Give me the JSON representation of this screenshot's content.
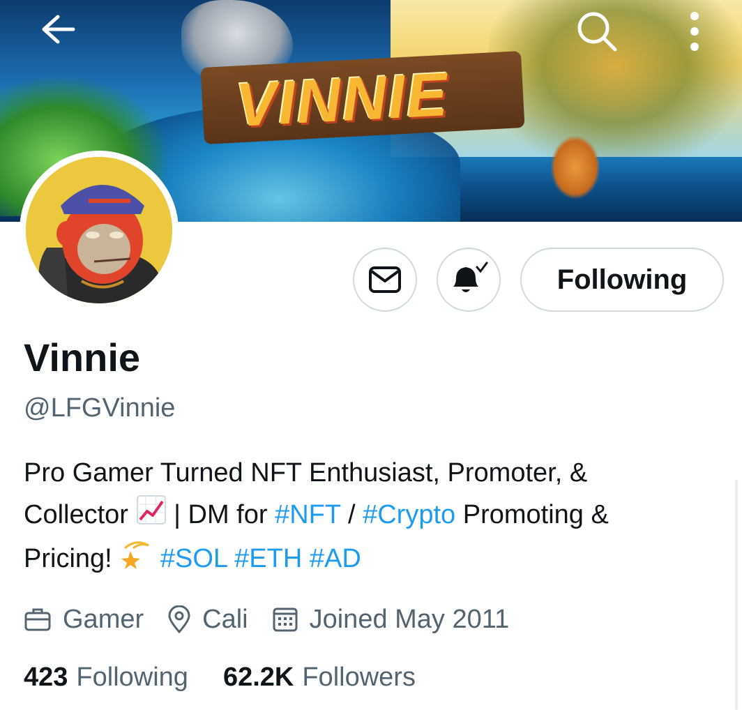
{
  "header": {
    "back_icon": "arrow-left-icon",
    "search_icon": "search-icon",
    "more_icon": "more-vertical-icon",
    "banner_logo_text": "VINNIE"
  },
  "profile": {
    "display_name": "Vinnie",
    "handle": "@LFGVinnie",
    "bio": {
      "line1": "Pro Gamer Turned NFT Enthusiast, Promoter, &",
      "line2_a": "Collector",
      "line2_b": "| DM for",
      "tag_nft": "#NFT",
      "sep": "/",
      "tag_crypto": "#Crypto",
      "line2_c": "Promoting &",
      "line3_a": "Pricing!",
      "tag_sol": "#SOL",
      "tag_eth": "#ETH",
      "tag_ad": "#AD"
    },
    "meta": {
      "category": "Gamer",
      "location": "Cali",
      "joined": "Joined May 2011"
    },
    "stats": {
      "following_count": "423",
      "following_label": "Following",
      "followers_count": "62.2K",
      "followers_label": "Followers"
    }
  },
  "actions": {
    "message_icon": "envelope-icon",
    "notify_icon": "bell-check-icon",
    "follow_label": "Following"
  },
  "colors": {
    "link": "#1d9bf0",
    "secondary_text": "#536471",
    "border": "#cfd9de"
  }
}
